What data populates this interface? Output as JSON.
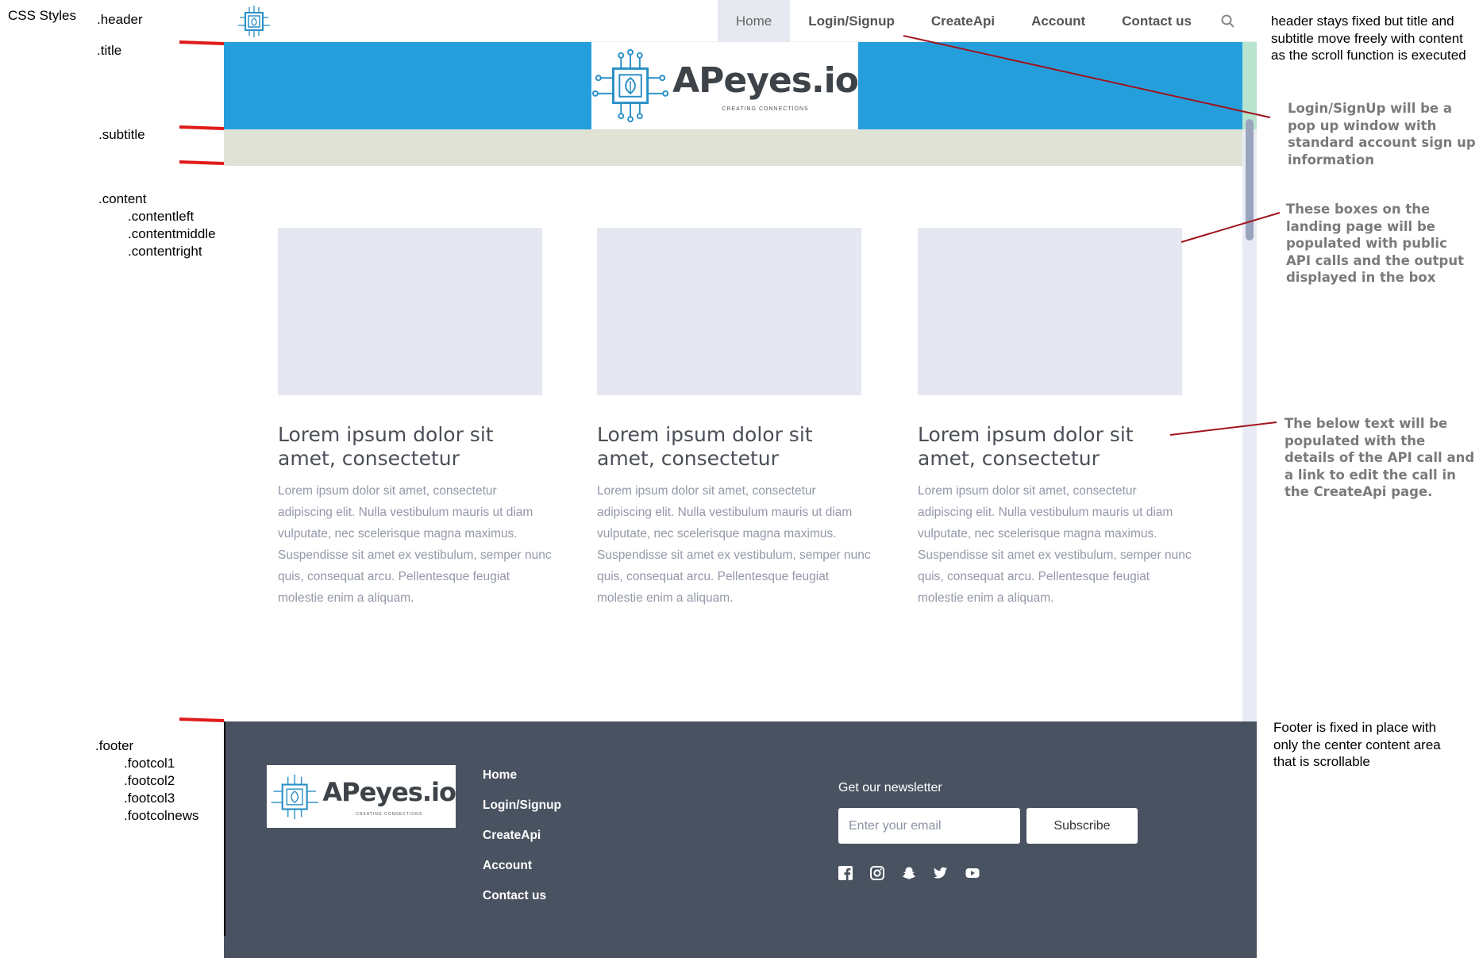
{
  "css_labels": {
    "css_styles": "CSS Styles",
    "header": ".header",
    "title": ".title",
    "subtitle": ".subtitle",
    "content": ".content",
    "contentleft": ".contentleft",
    "contentmiddle": ".contentmiddle",
    "contentright": ".contentright",
    "footer": ".footer",
    "footcol1": ".footcol1",
    "footcol2": ".footcol2",
    "footcol3": ".footcol3",
    "footcolnews": ".footcolnews"
  },
  "header": {
    "nav": [
      "Home",
      "Login/Signup",
      "CreateApi",
      "Account",
      "Contact us"
    ],
    "search_icon": "search-icon"
  },
  "brand": {
    "name": "APeyes.io",
    "tagline": "CREATING CONNECTIONS"
  },
  "cards": [
    {
      "title": "Lorem ipsum dolor sit amet, consectetur",
      "text": "Lorem ipsum dolor sit amet, consectetur adipiscing elit. Nulla vestibulum mauris ut diam vulputate, nec scelerisque magna maximus. Suspendisse sit amet ex vestibulum, semper nunc quis, consequat arcu. Pellentesque feugiat molestie enim a aliquam."
    },
    {
      "title": "Lorem ipsum dolor sit amet, consectetur",
      "text": "Lorem ipsum dolor sit amet, consectetur adipiscing elit. Nulla vestibulum mauris ut diam vulputate, nec scelerisque magna maximus. Suspendisse sit amet ex vestibulum, semper nunc quis, consequat arcu. Pellentesque feugiat molestie enim a aliquam."
    },
    {
      "title": "Lorem ipsum dolor sit amet, consectetur",
      "text": "Lorem ipsum dolor sit amet, consectetur adipiscing elit. Nulla vestibulum mauris ut diam vulputate, nec scelerisque magna maximus. Suspendisse sit amet ex vestibulum, semper nunc quis, consequat arcu. Pellentesque feugiat molestie enim a aliquam."
    }
  ],
  "footer": {
    "links": [
      "Home",
      "Login/Signup",
      "CreateApi",
      "Account",
      "Contact us"
    ],
    "newsletter_title": "Get our newsletter",
    "email_placeholder": "Enter your email",
    "subscribe_label": "Subscribe",
    "socials": [
      "facebook-icon",
      "instagram-icon",
      "snapchat-icon",
      "twitter-icon",
      "youtube-icon"
    ]
  },
  "annotations": {
    "header_note": "header stays fixed but title and subtitle move freely with content as the scroll function is executed",
    "login_note": "Login/SignUp will be a pop up window with standard account sign up information",
    "boxes_note": "These boxes on the landing page will be populated with public API calls and the output displayed in the box",
    "text_note": "The below text will be populated with the details of the API call and a link to edit the call in the CreateApi page.",
    "footer_note": "Footer is fixed in place with only the center content area that is scrollable"
  },
  "colors": {
    "title_band": "#259fdc",
    "subtitle_band": "#dfe2d4",
    "footer_bg": "#495260",
    "card_placeholder": "#e5e8f0",
    "annotation_line": "#a0141e",
    "marker": "#e01a1a"
  }
}
